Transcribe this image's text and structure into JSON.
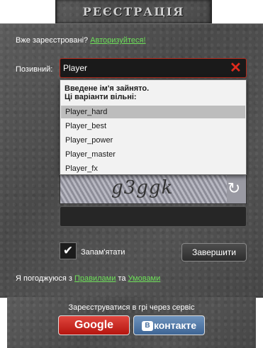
{
  "title": "РЕЄСТРАЦІЯ",
  "login_prompt": {
    "text": "Вже зареєстровані?",
    "link": "Авторизуйтеся!"
  },
  "nickname": {
    "label": "Позивний:",
    "value": "Player"
  },
  "suggestions": {
    "message_line1": "Введене ім'я зайнято.",
    "message_line2": "Ці варіанти вільні:",
    "items": [
      "Player_hard",
      "Player_best",
      "Player_power",
      "Player_master",
      "Player_fx"
    ]
  },
  "captcha": {
    "code": "g3ggk"
  },
  "remember": {
    "label": "Запам'ятати",
    "checked": true
  },
  "finish_button": "Завершити",
  "agreement": {
    "prefix": "Я погоджуюся з",
    "rules_link": "Правилами",
    "conjunction": "та",
    "terms_link": "Умовами"
  },
  "social": {
    "label": "Зареєструватися в грі через сервіс",
    "google": "Google",
    "vk_mark": "В",
    "vk": "контакте"
  },
  "colors": {
    "link": "#6ee05a",
    "error_border": "#b52a1c",
    "google": "#c8221a",
    "vk": "#4b72a0"
  }
}
